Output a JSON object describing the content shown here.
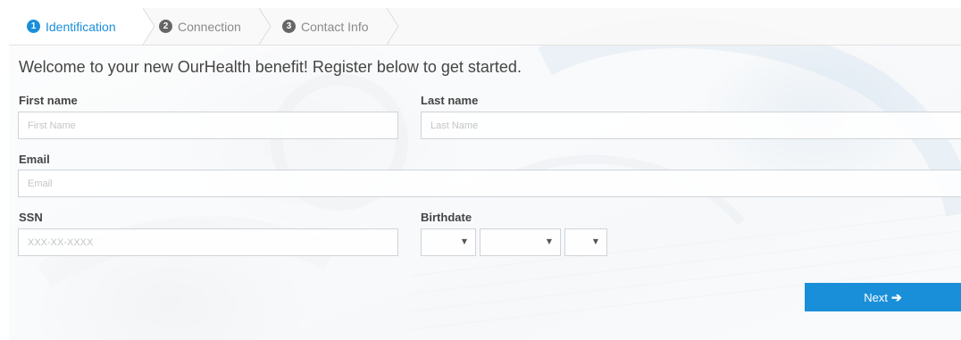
{
  "tabs": [
    {
      "number": "1",
      "label": "Identification",
      "active": true
    },
    {
      "number": "2",
      "label": "Connection",
      "active": false
    },
    {
      "number": "3",
      "label": "Contact Info",
      "active": false
    }
  ],
  "welcome": "Welcome to your new OurHealth benefit! Register below to get started.",
  "form": {
    "first_name": {
      "label": "First name",
      "placeholder": "First Name"
    },
    "last_name": {
      "label": "Last name",
      "placeholder": "Last Name"
    },
    "email": {
      "label": "Email",
      "placeholder": "Email"
    },
    "ssn": {
      "label": "SSN",
      "placeholder": "XXX-XX-XXXX"
    },
    "birthdate": {
      "label": "Birthdate",
      "month": "",
      "day": "",
      "year": ""
    }
  },
  "next_button": {
    "label": "Next",
    "icon": "arrow-right-icon"
  },
  "colors": {
    "accent": "#1a8fd9",
    "tab_inactive": "#8a8a8a",
    "text": "#444444"
  }
}
